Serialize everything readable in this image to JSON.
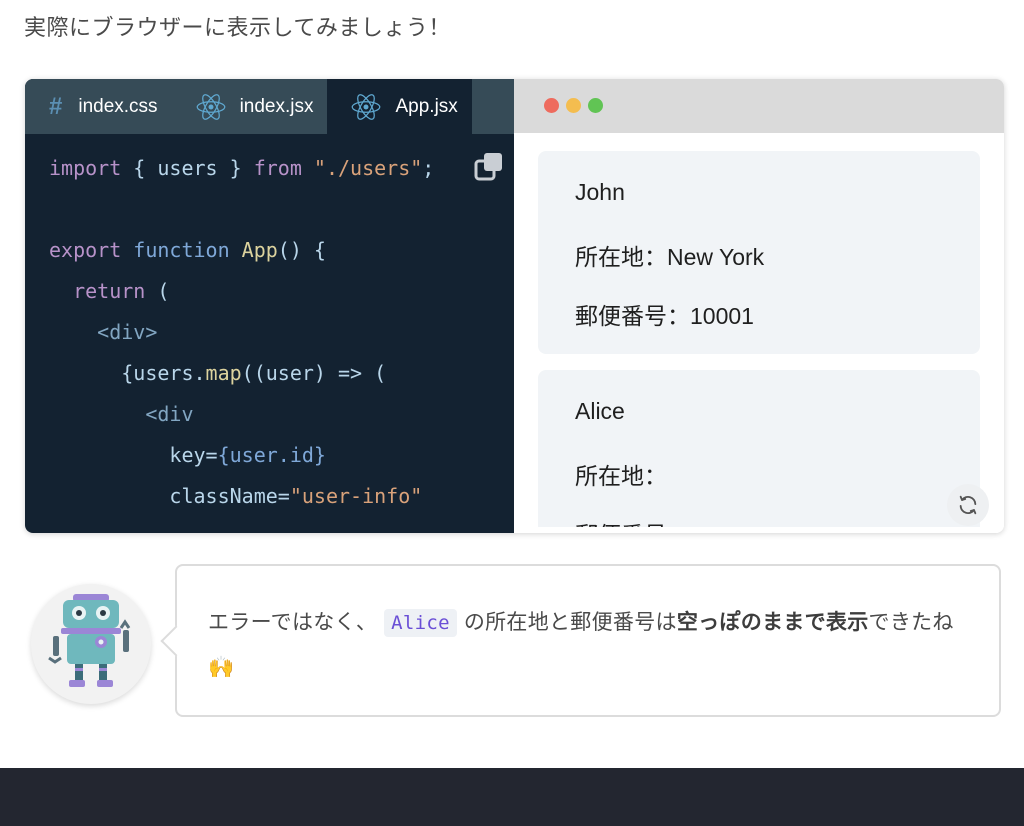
{
  "intro_text": "実際にブラウザーに表示してみましょう！",
  "editor": {
    "tabs": [
      {
        "label": "index.css",
        "icon": "css-hash-icon"
      },
      {
        "label": "index.jsx",
        "icon": "react-icon"
      },
      {
        "label": "App.jsx",
        "icon": "react-icon",
        "active": true
      }
    ],
    "code": {
      "import_kw": "import",
      "import_names": " { users } ",
      "from_kw": "from",
      "import_path": "\"./users\"",
      "semicolon": ";",
      "export_kw": "export",
      "function_kw": "function",
      "fn_name": "App",
      "fn_sig": "() {",
      "return_kw": "return",
      "paren_open": " (",
      "div_open": "<div>",
      "map_prefix": "{users.",
      "map_fn": "map",
      "map_suffix": "((user) => (",
      "div_tag": "<div",
      "key_attr": "key=",
      "key_val": "{user.id}",
      "class_attr": "className=",
      "class_val": "\"user-info\""
    },
    "copy_icon": "copy-icon"
  },
  "preview": {
    "users": [
      {
        "name": "John",
        "location": "所在地：New York",
        "zip": "郵便番号：10001"
      },
      {
        "name": "Alice",
        "location": "所在地：",
        "zip": "郵便番号："
      }
    ],
    "refresh_icon": "refresh-icon"
  },
  "bubble": {
    "text_before": "エラーではなく、",
    "code": "Alice",
    "text_middle": "の所在地と郵便番号は",
    "bold": "空っぽのままで表示",
    "text_after": "できたね",
    "emoji": "🙌"
  },
  "colors": {
    "editor_bg": "#132231",
    "tabs_bg": "#364b57",
    "keyword": "#b792c9",
    "string": "#d9a27a",
    "inline_code": "#6a4fd6",
    "footer": "#232630"
  }
}
